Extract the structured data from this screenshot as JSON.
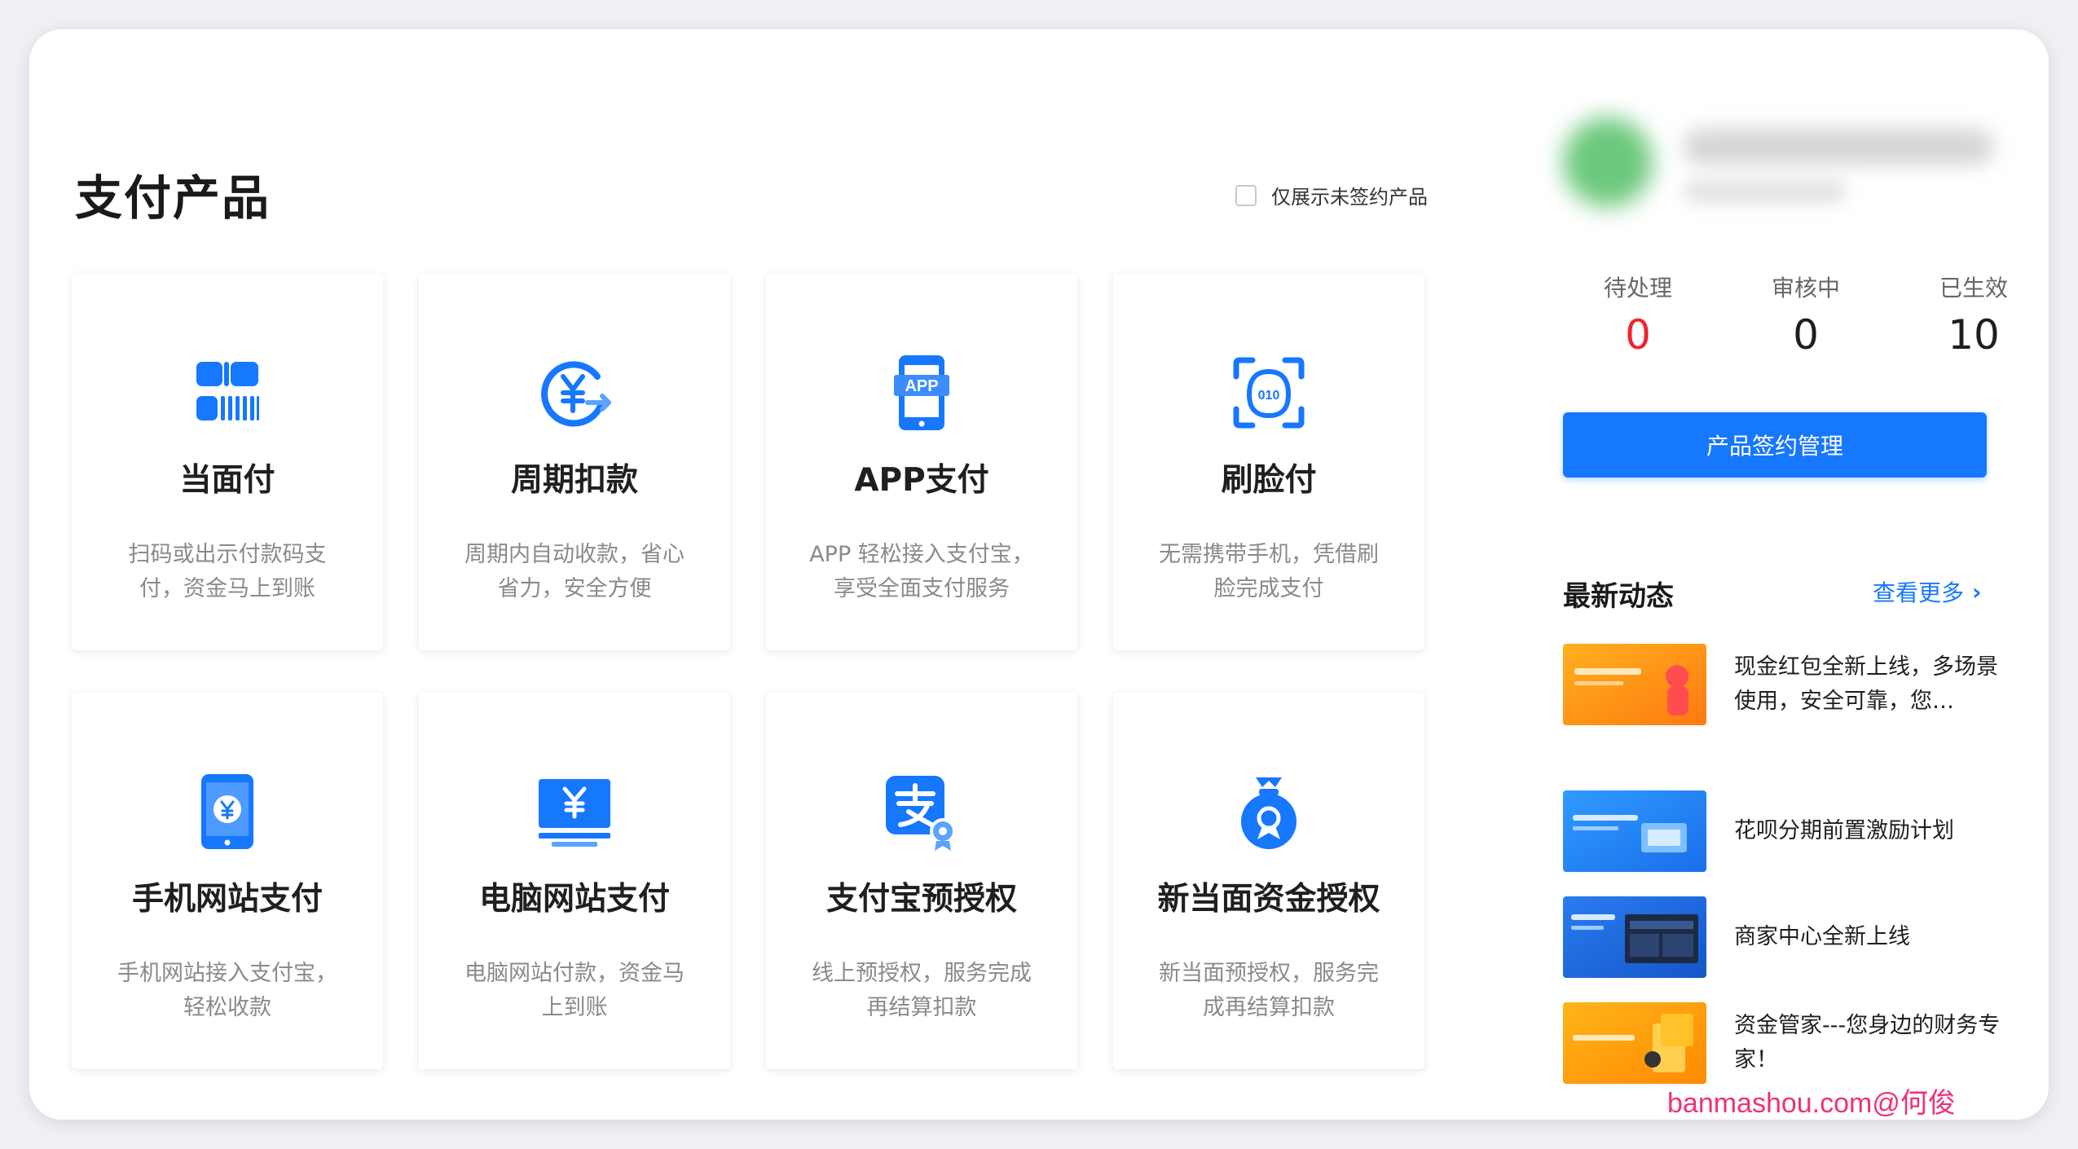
{
  "page": {
    "title": "支付产品"
  },
  "filter": {
    "label": "仅展示未签约产品",
    "checked": false
  },
  "products": [
    {
      "name": "当面付",
      "desc": "扫码或出示付款码支付，资金马上到账",
      "icon": "qr-barcode-icon"
    },
    {
      "name": "周期扣款",
      "desc": "周期内自动收款，省心省力，安全方便",
      "icon": "cycle-yuan-icon"
    },
    {
      "name": "APP支付",
      "desc": "APP 轻松接入支付宝，享受全面支付服务",
      "icon": "app-phone-icon"
    },
    {
      "name": "刷脸付",
      "desc": "无需携带手机，凭借刷脸完成支付",
      "icon": "face-scan-icon"
    },
    {
      "name": "手机网站支付",
      "desc": "手机网站接入支付宝，轻松收款",
      "icon": "mobile-yuan-icon"
    },
    {
      "name": "电脑网站支付",
      "desc": "电脑网站付款，资金马上到账",
      "icon": "monitor-yuan-icon"
    },
    {
      "name": "支付宝预授权",
      "desc": "线上预授权，服务完成再结算扣款",
      "icon": "alipay-auth-icon"
    },
    {
      "name": "新当面资金授权",
      "desc": "新当面预授权，服务完成再结算扣款",
      "icon": "fund-bag-icon"
    }
  ],
  "stats": [
    {
      "label": "待处理",
      "value": "0",
      "color": "#f5222d"
    },
    {
      "label": "审核中",
      "value": "0",
      "color": "#1f1f1f"
    },
    {
      "label": "已生效",
      "value": "10",
      "color": "#1f1f1f"
    }
  ],
  "manage_button": "产品签约管理",
  "news": {
    "title": "最新动态",
    "more_label": "查看更多",
    "items": [
      {
        "text": "现金红包全新上线，多场景使用，安全可靠，您…",
        "thumb": "orange"
      },
      {
        "text": "花呗分期前置激励计划",
        "thumb": "blue"
      },
      {
        "text": "商家中心全新上线",
        "thumb": "blue-dark"
      },
      {
        "text": "资金管家---您身边的财务专家！",
        "thumb": "orange-yellow"
      }
    ]
  },
  "watermark": "banmashou.com@何俊",
  "colors": {
    "primary": "#1677ff",
    "alert": "#f5222d",
    "watermark": "#f0307a"
  }
}
